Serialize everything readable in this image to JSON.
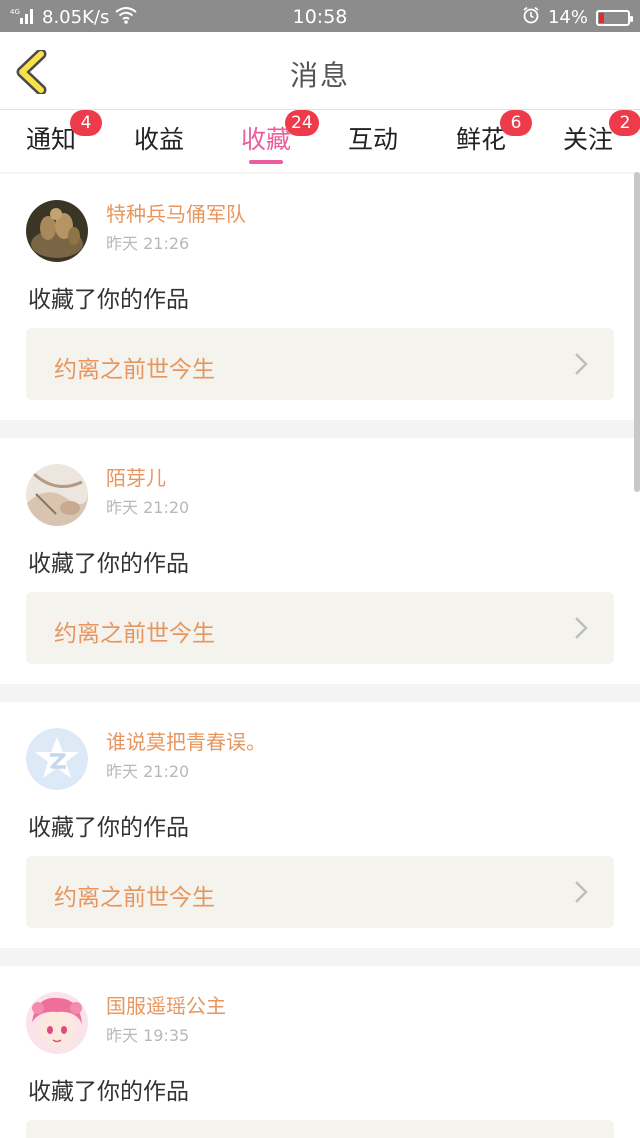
{
  "status_bar": {
    "network": "4G",
    "speed": "8.05K/s",
    "time": "10:58",
    "battery": "14%"
  },
  "header": {
    "title": "消息"
  },
  "tabs": [
    {
      "label": "通知",
      "badge": "4"
    },
    {
      "label": "收益",
      "badge": ""
    },
    {
      "label": "收藏",
      "badge": "24",
      "active": true
    },
    {
      "label": "互动",
      "badge": ""
    },
    {
      "label": "鲜花",
      "badge": "6"
    },
    {
      "label": "关注",
      "badge": "2"
    }
  ],
  "items": [
    {
      "user": "特种兵马俑军队",
      "time": "昨天 21:26",
      "action": "收藏了你的作品",
      "work": "约离之前世今生"
    },
    {
      "user": "陌芽儿",
      "time": "昨天 21:20",
      "action": "收藏了你的作品",
      "work": "约离之前世今生"
    },
    {
      "user": "谁说莫把青春误。",
      "time": "昨天 21:20",
      "action": "收藏了你的作品",
      "work": "约离之前世今生"
    },
    {
      "user": "国服遥瑶公主",
      "time": "昨天 19:35",
      "action": "收藏了你的作品",
      "work": ""
    }
  ],
  "colors": {
    "accent": "#ea5e9d",
    "badge": "#ee3b4c",
    "name": "#e8965f",
    "time": "#b8b8b8"
  }
}
